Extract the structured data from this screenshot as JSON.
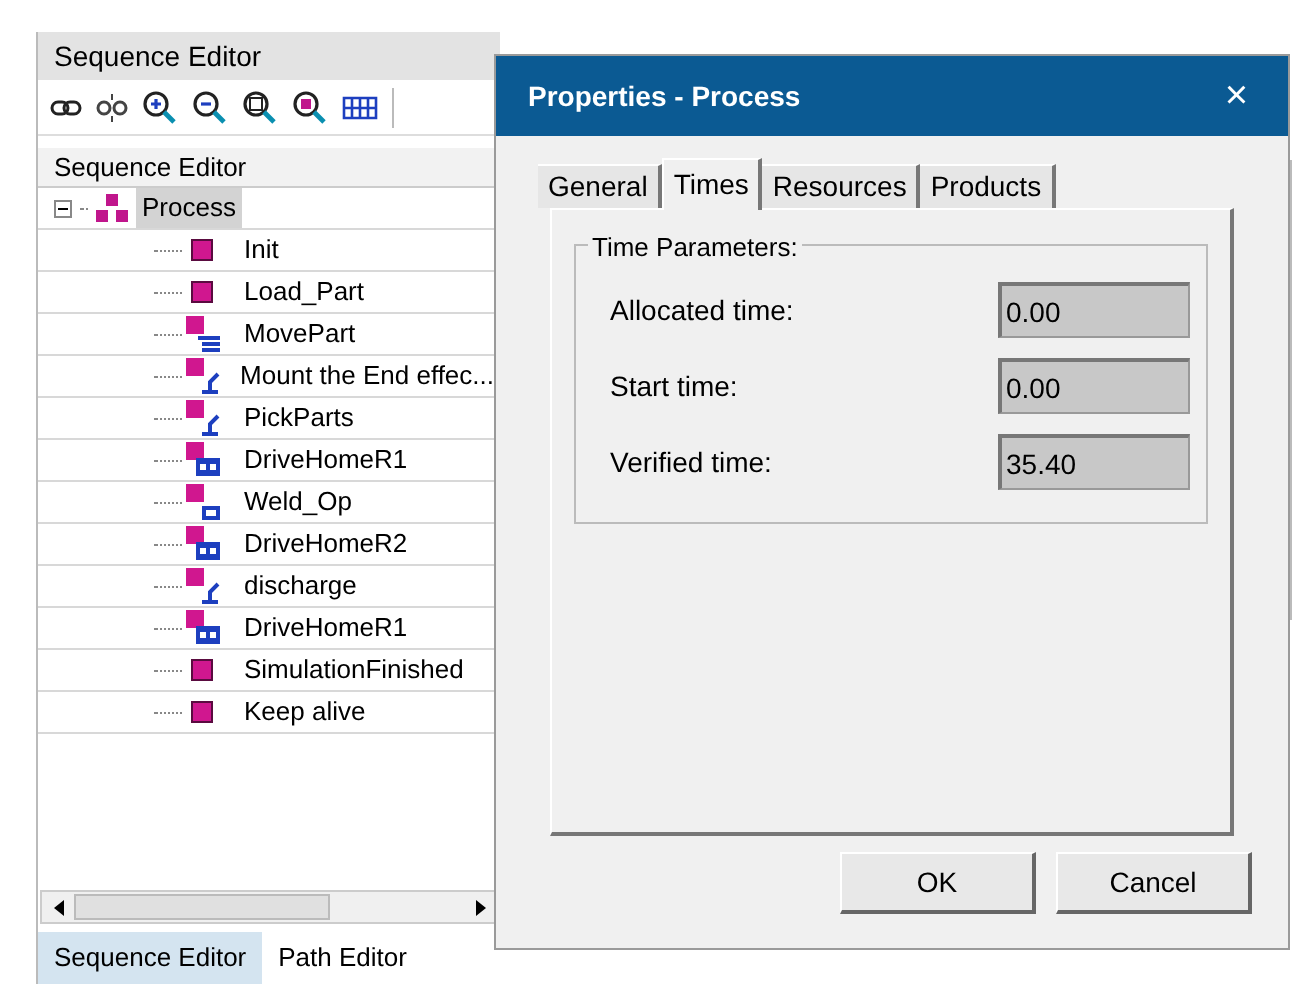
{
  "panel": {
    "title": "Sequence Editor",
    "column_header": "Sequence Editor"
  },
  "tree": [
    {
      "label": "Process",
      "kind": "compound",
      "expanded": true,
      "selected": true,
      "children": [
        {
          "label": "Init",
          "kind": "operation",
          "selected": false
        },
        {
          "label": "Load_Part",
          "kind": "operation",
          "selected": false
        },
        {
          "label": "MovePart",
          "kind": "move",
          "selected": false
        },
        {
          "label": "Mount the End effec...",
          "kind": "robot",
          "selected": false
        },
        {
          "label": "PickParts",
          "kind": "robot",
          "selected": false
        },
        {
          "label": "DriveHomeR1",
          "kind": "drive",
          "selected": false
        },
        {
          "label": "Weld_Op",
          "kind": "weld",
          "selected": false
        },
        {
          "label": "DriveHomeR2",
          "kind": "drive",
          "selected": false
        },
        {
          "label": "discharge",
          "kind": "robot",
          "selected": false
        },
        {
          "label": "DriveHomeR1",
          "kind": "drive",
          "selected": false
        },
        {
          "label": "SimulationFinished",
          "kind": "operation",
          "selected": false
        },
        {
          "label": "Keep alive",
          "kind": "operation",
          "selected": false
        }
      ]
    }
  ],
  "bottom_tabs": [
    {
      "label": "Sequence Editor",
      "selected": true
    },
    {
      "label": "Path Editor",
      "selected": false
    }
  ],
  "dialog": {
    "title": "Properties - Process",
    "close": "×",
    "tabs": [
      {
        "label": "General",
        "selected": false
      },
      {
        "label": "Times",
        "selected": true
      },
      {
        "label": "Resources",
        "selected": false
      },
      {
        "label": "Products",
        "selected": false
      }
    ],
    "group_title": "Time Parameters:",
    "fields": [
      {
        "label": "Allocated time:",
        "value": "0.00"
      },
      {
        "label": "Start time:",
        "value": "0.00"
      },
      {
        "label": "Verified time:",
        "value": "35.40"
      }
    ],
    "buttons": [
      "OK",
      "Cancel"
    ]
  }
}
